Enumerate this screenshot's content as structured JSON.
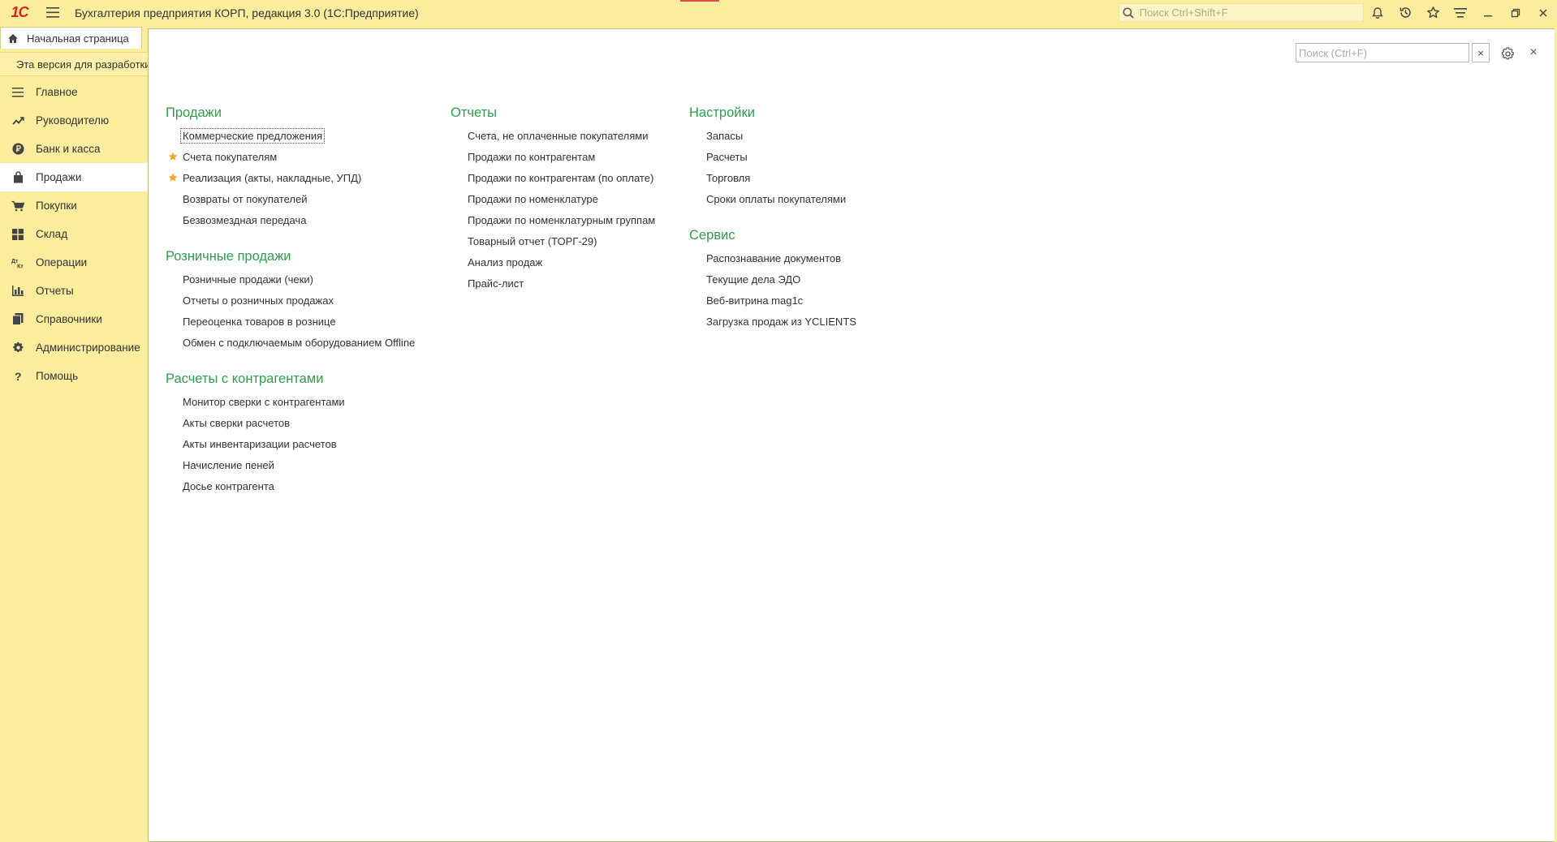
{
  "app": {
    "title": "Бухгалтерия предприятия КОРП, редакция 3.0  (1С:Предприятие)",
    "logo_text": "1С",
    "search_placeholder": "Поиск Ctrl+Shift+F",
    "colors": {
      "background": "#fbed9e",
      "accent_green": "#2e9e49",
      "star": "#f0a830"
    }
  },
  "tabs": {
    "home": "Начальная страница"
  },
  "warning": {
    "text": "Эта версия для разработки"
  },
  "sidebar": {
    "items": [
      {
        "label": "Главное",
        "icon": "menu-icon"
      },
      {
        "label": "Руководителю",
        "icon": "trend-icon"
      },
      {
        "label": "Банк и касса",
        "icon": "ruble-icon"
      },
      {
        "label": "Продажи",
        "icon": "bag-icon",
        "active": true
      },
      {
        "label": "Покупки",
        "icon": "cart-icon"
      },
      {
        "label": "Склад",
        "icon": "warehouse-icon"
      },
      {
        "label": "Операции",
        "icon": "dt-kt-icon"
      },
      {
        "label": "Отчеты",
        "icon": "bar-chart-icon"
      },
      {
        "label": "Справочники",
        "icon": "books-icon"
      },
      {
        "label": "Администрирование",
        "icon": "gear-icon"
      },
      {
        "label": "Помощь",
        "icon": "help-icon"
      }
    ]
  },
  "panel": {
    "search_placeholder": "Поиск (Ctrl+F)",
    "clear_label": "×",
    "close_label": "×"
  },
  "columns": [
    {
      "sections": [
        {
          "title": "Продажи",
          "links": [
            {
              "label": "Коммерческие предложения",
              "focused": true
            },
            {
              "label": "Счета покупателям",
              "starred": true
            },
            {
              "label": "Реализация (акты, накладные, УПД)",
              "starred": true
            },
            {
              "label": "Возвраты от покупателей"
            },
            {
              "label": "Безвозмездная передача"
            }
          ]
        },
        {
          "title": "Розничные продажи",
          "links": [
            {
              "label": "Розничные продажи (чеки)"
            },
            {
              "label": "Отчеты о розничных продажах"
            },
            {
              "label": "Переоценка товаров в рознице"
            },
            {
              "label": "Обмен с подключаемым оборудованием Offline"
            }
          ]
        },
        {
          "title": "Расчеты с контрагентами",
          "links": [
            {
              "label": "Монитор сверки с контрагентами"
            },
            {
              "label": "Акты сверки расчетов"
            },
            {
              "label": "Акты инвентаризации расчетов"
            },
            {
              "label": "Начисление пеней"
            },
            {
              "label": "Досье контрагента"
            }
          ]
        }
      ]
    },
    {
      "sections": [
        {
          "title": "Отчеты",
          "links": [
            {
              "label": "Счета, не оплаченные покупателями"
            },
            {
              "label": "Продажи по контрагентам"
            },
            {
              "label": "Продажи по контрагентам (по оплате)"
            },
            {
              "label": "Продажи по номенклатуре"
            },
            {
              "label": "Продажи по номенклатурным группам"
            },
            {
              "label": "Товарный отчет (ТОРГ-29)"
            },
            {
              "label": "Анализ продаж"
            },
            {
              "label": "Прайс-лист"
            }
          ]
        }
      ]
    },
    {
      "sections": [
        {
          "title": "Настройки",
          "links": [
            {
              "label": "Запасы"
            },
            {
              "label": "Расчеты"
            },
            {
              "label": "Торговля"
            },
            {
              "label": "Сроки оплаты покупателями"
            }
          ]
        },
        {
          "title": "Сервис",
          "links": [
            {
              "label": "Распознавание документов"
            },
            {
              "label": "Текущие дела ЭДО"
            },
            {
              "label": "Веб-витрина mag1c"
            },
            {
              "label": "Загрузка продаж из YCLIENTS"
            }
          ]
        }
      ]
    }
  ]
}
